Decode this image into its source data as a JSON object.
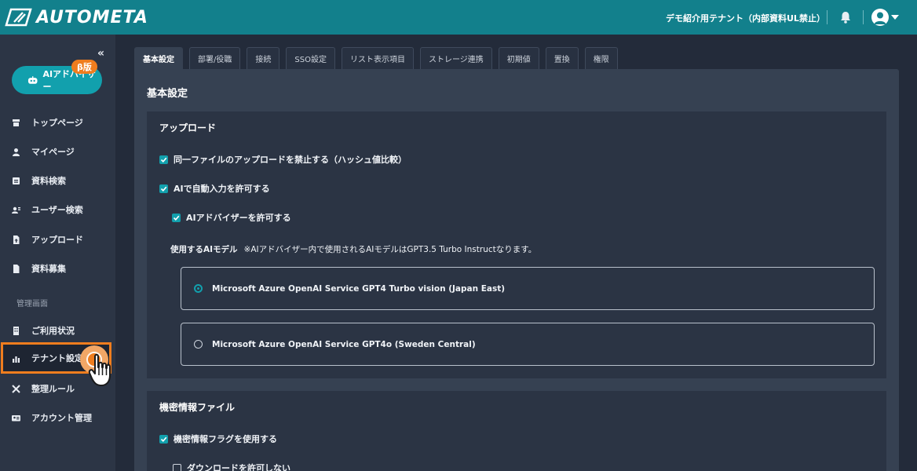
{
  "header": {
    "logo_text": "AUTOMETA",
    "tenant_name": "デモ紹介用テナント（内部資料UL禁止）"
  },
  "sidebar": {
    "ai_button_label": "AIアドバイザー",
    "beta_badge": "β版",
    "items_top": [
      {
        "label": "トップページ",
        "icon": "store-icon"
      },
      {
        "label": "マイページ",
        "icon": "person-icon"
      },
      {
        "label": "資料検索",
        "icon": "document-search-icon"
      },
      {
        "label": "ユーザー検索",
        "icon": "user-search-icon"
      },
      {
        "label": "アップロード",
        "icon": "upload-file-icon"
      },
      {
        "label": "資料募集",
        "icon": "file-icon"
      }
    ],
    "admin_section_label": "管理画面",
    "items_admin": [
      {
        "label": "ご利用状況",
        "icon": "building-icon"
      },
      {
        "label": "テナント設定",
        "icon": "bar-chart-icon",
        "active": true
      },
      {
        "label": "整理ルール",
        "icon": "tools-icon"
      },
      {
        "label": "アカウント管理",
        "icon": "id-card-icon"
      }
    ]
  },
  "tabs": [
    {
      "label": "基本設定",
      "active": true
    },
    {
      "label": "部署/役職"
    },
    {
      "label": "接続"
    },
    {
      "label": "SSO設定"
    },
    {
      "label": "リスト表示項目"
    },
    {
      "label": "ストレージ連携"
    },
    {
      "label": "初期値"
    },
    {
      "label": "置換"
    },
    {
      "label": "権限"
    }
  ],
  "panel": {
    "title": "基本設定",
    "upload_section": {
      "title": "アップロード",
      "checkbox_duplicate": {
        "label": "同一ファイルのアップロードを禁止する（ハッシュ値比較）",
        "checked": true
      },
      "checkbox_ai_input": {
        "label": "AIで自動入力を許可する",
        "checked": true
      },
      "checkbox_ai_advisor": {
        "label": "AIアドバイザーを許可する",
        "checked": true
      },
      "model_label": "使用するAIモデル",
      "model_note": "※AIアドバイザー内で使用されるAIモデルはGPT3.5 Turbo Instructなります。",
      "model_options": [
        {
          "label": "Microsoft Azure OpenAI Service GPT4 Turbo vision (Japan East)",
          "selected": true
        },
        {
          "label": "Microsoft Azure OpenAI Service GPT4o (Sweden Central)",
          "selected": false
        }
      ]
    },
    "confidential_section": {
      "title": "機密情報ファイル",
      "checkbox_use_flag": {
        "label": "機密情報フラグを使用する",
        "checked": true
      },
      "checkbox_no_download": {
        "label": "ダウンロードを許可しない",
        "checked": false
      }
    }
  },
  "colors": {
    "header": "#12808c",
    "accent": "#12a0ad",
    "highlight": "#ef7d1e"
  }
}
